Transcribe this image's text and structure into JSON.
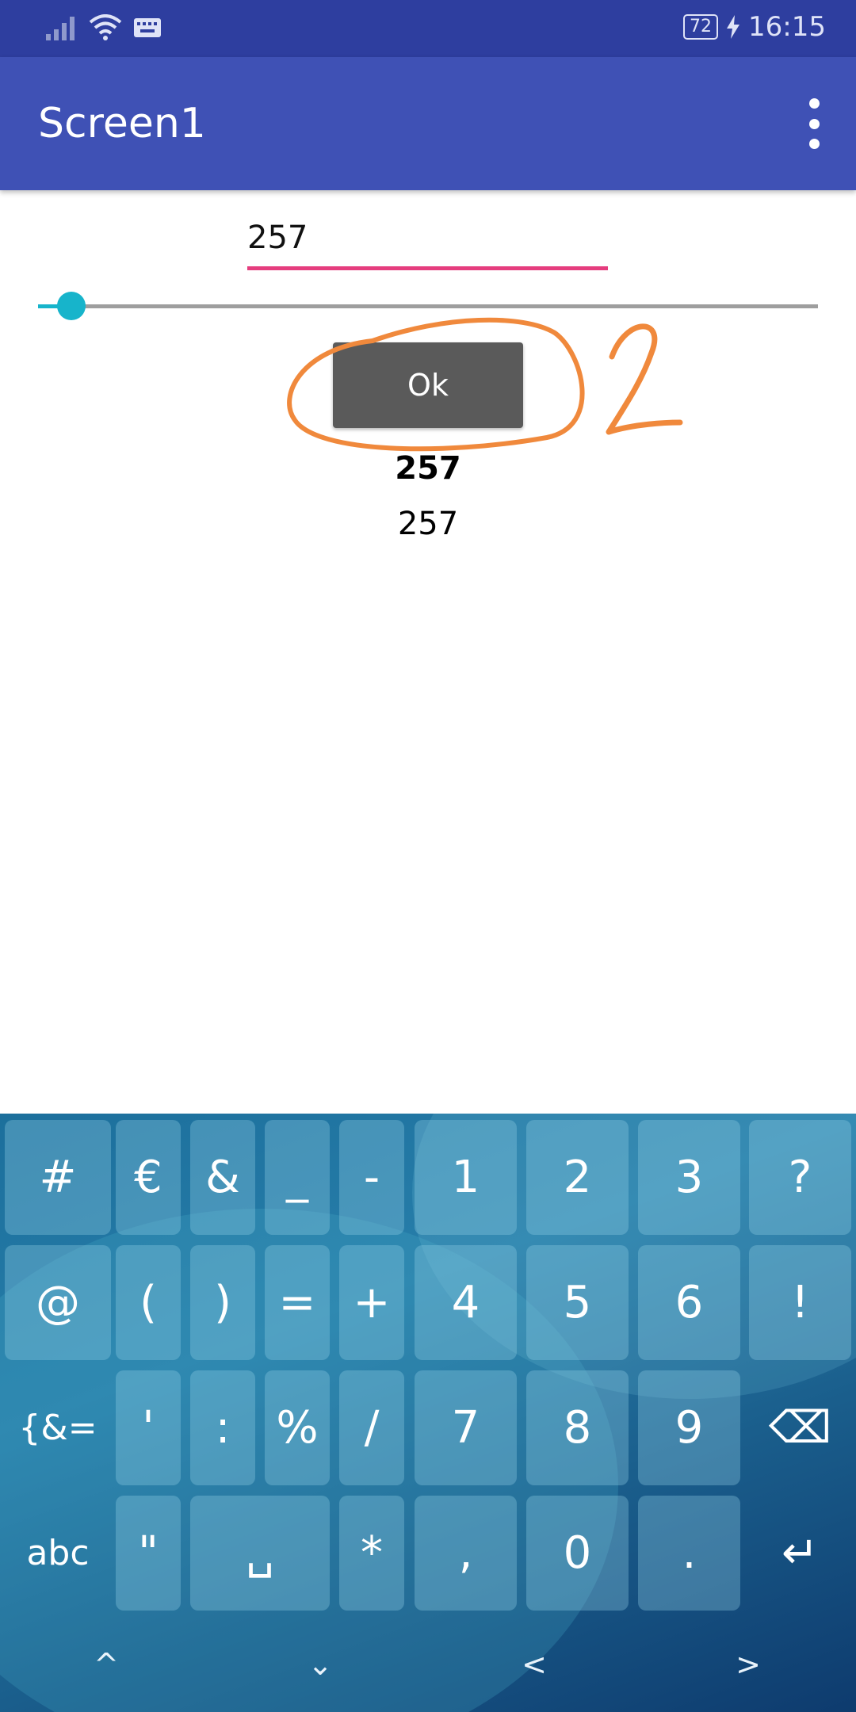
{
  "status_bar": {
    "battery_level": "72",
    "time": "16:15",
    "icons": [
      "signal-icon",
      "wifi-icon",
      "keyboard-icon",
      "charging-icon"
    ]
  },
  "app_bar": {
    "title": "Screen1",
    "menu_icon": "overflow-menu-icon"
  },
  "content": {
    "textbox_value": "257",
    "slider": {
      "value_fraction": 0.03
    },
    "button_label": "Ok",
    "label_bold": "257",
    "label_regular": "257"
  },
  "keyboard": {
    "row1": [
      "#",
      "€",
      "&",
      "_",
      "-",
      "1",
      "2",
      "3",
      "?"
    ],
    "row2": [
      "@",
      "(",
      ")",
      "=",
      "+",
      "4",
      "5",
      "6",
      "!"
    ],
    "row3": [
      "{&=",
      "'",
      ":",
      "%",
      "/",
      "7",
      "8",
      "9",
      "⌫"
    ],
    "row4": [
      "abc",
      "\"",
      "␣",
      "*",
      ",",
      "0",
      ".",
      "↵"
    ]
  },
  "nav_bar": {
    "arrows": [
      "^",
      "⌄",
      "<",
      ">"
    ]
  },
  "colors": {
    "status_bar": "#2e3e9f",
    "app_bar": "#3f51b5",
    "textbox_underline": "#e53d7e",
    "slider_accent": "#17b4cb",
    "annotation": "#f0893c"
  }
}
